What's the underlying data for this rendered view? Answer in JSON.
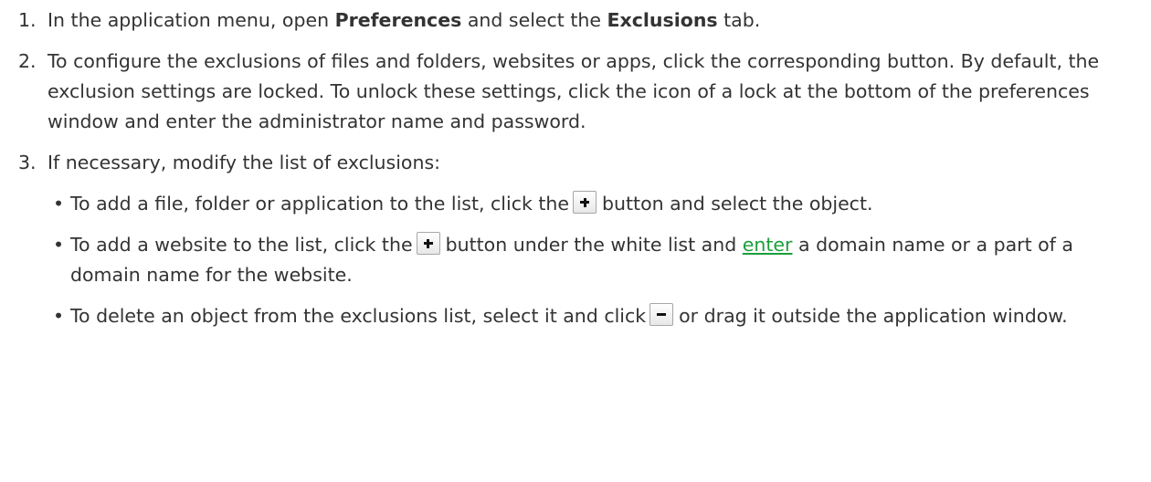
{
  "steps": [
    {
      "number": "1.",
      "t1": "In the application menu, open ",
      "b1": "Preferences",
      "t2": " and select the ",
      "b2": "Exclusions",
      "t3": " tab."
    },
    {
      "number": "2.",
      "text": "To configure the exclusions of files and folders, websites or apps, click the corresponding button. By default, the exclusion settings are locked. To unlock these settings, click the icon of a lock at the bottom of the preferences window and enter the administrator name and password."
    },
    {
      "number": "3.",
      "text": "If necessary, modify the list of exclusions:",
      "bullets": [
        {
          "t1": "To add a file, folder or application to the list, click the",
          "t2": "button and select the object.",
          "icon": "plus-button-icon"
        },
        {
          "t1": "To add a website to the list, click the",
          "t2": "button under the white list and",
          "link": "enter",
          "t3": " a domain name or a part of a domain name for the website.",
          "icon": "plus-button-icon"
        },
        {
          "t1": "To delete an object from the exclusions list, select it and click",
          "t2": "or drag it outside the application window.",
          "icon": "minus-button-icon"
        }
      ]
    }
  ],
  "colors": {
    "text": "#333333",
    "link": "#1a9e3a"
  }
}
